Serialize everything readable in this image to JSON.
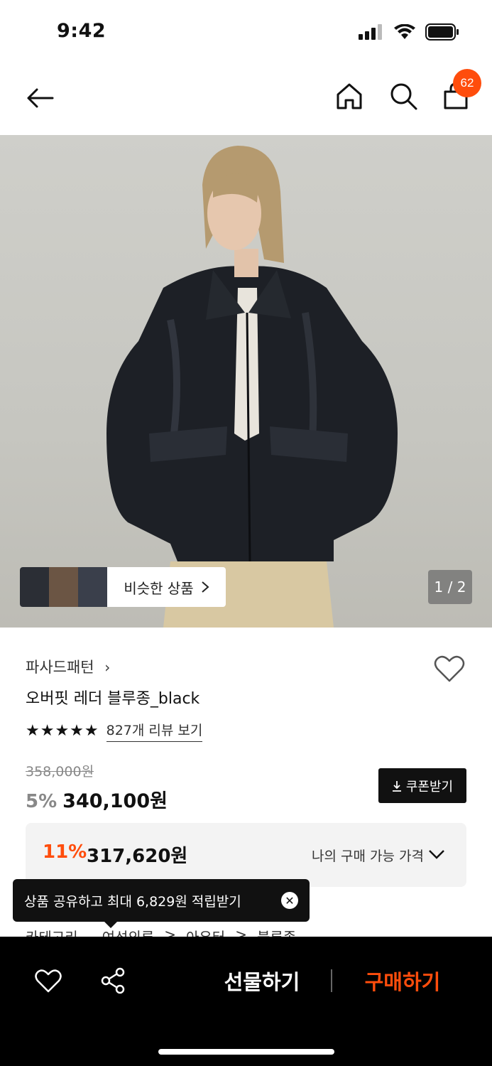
{
  "status_bar": {
    "time": "9:42"
  },
  "nav": {
    "cart_count": "62"
  },
  "hero": {
    "similar_label": "비슷한 상품",
    "page_indicator": "1 / 2"
  },
  "product": {
    "brand": "파사드패턴",
    "name": "오버핏 레더 블루종_black",
    "rating_stars": 5,
    "review_link": "827개 리뷰 보기",
    "original_price": "358,000원",
    "discount_rate": "5%",
    "sale_price": "340,100원",
    "coupon_label": "쿠폰받기",
    "my_price": {
      "rate": "11%",
      "price": "317,620원",
      "label": "나의 구매 가능 가격"
    },
    "category": [
      "카테고리",
      "여성의류",
      ">",
      "아우터",
      ">",
      "블루종"
    ]
  },
  "toast": {
    "message": "상품 공유하고 최대 6,829원 적립받기"
  },
  "bottom_bar": {
    "gift_label": "선물하기",
    "buy_label": "구매하기"
  },
  "colors": {
    "accent": "#ff4d0c",
    "dark": "#111111"
  }
}
